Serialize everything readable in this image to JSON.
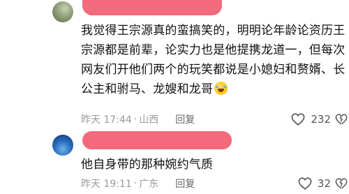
{
  "comments": [
    {
      "text": "我觉得王宗源真的蛮搞笑的，明明论年龄论资历王宗源都是前辈，论实力也是他提携龙道一，但每次网友们开他们两个的玩笑都说是小媳妇和赘婿、长公主和驸马、龙嫂和龙哥",
      "emoji": "laughing-with-tears-emoji",
      "time": "昨天 17:44",
      "separator": "·",
      "location": "山西",
      "reply_label": "回复",
      "likes": "232"
    },
    {
      "text": "他自身带的那种婉约气质",
      "time": "昨天 19:11",
      "separator": "·",
      "location": "广东",
      "reply_label": "回复",
      "likes": "32"
    }
  ],
  "colors": {
    "redaction": "#f26a7c",
    "meta": "#9a9a9a",
    "text": "#111111"
  }
}
